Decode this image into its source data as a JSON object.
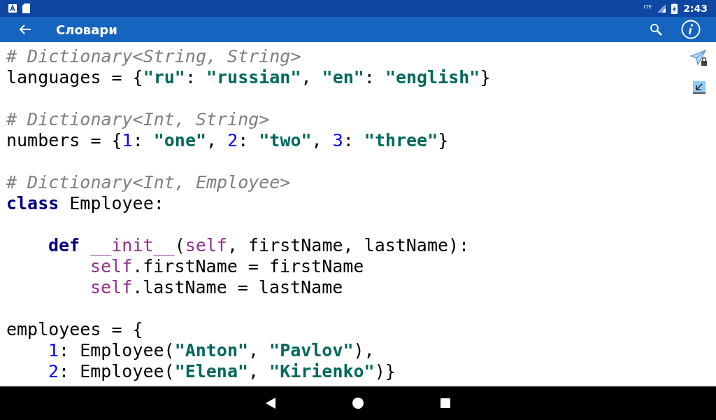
{
  "status_bar": {
    "time": "2:43",
    "network": "LTE"
  },
  "toolbar": {
    "title": "Словари"
  },
  "code_lines": [
    {
      "kind": "code",
      "tokens": [
        {
          "kind": "comment",
          "text": "# Dictionary<String, String>"
        }
      ]
    },
    {
      "kind": "code",
      "tokens": [
        {
          "kind": "plain",
          "text": "languages = {"
        },
        {
          "kind": "string",
          "text": "\"ru\""
        },
        {
          "kind": "plain",
          "text": ": "
        },
        {
          "kind": "string",
          "text": "\"russian\""
        },
        {
          "kind": "plain",
          "text": ", "
        },
        {
          "kind": "string",
          "text": "\"en\""
        },
        {
          "kind": "plain",
          "text": ": "
        },
        {
          "kind": "string",
          "text": "\"english\""
        },
        {
          "kind": "plain",
          "text": "}"
        }
      ]
    },
    {
      "kind": "blank"
    },
    {
      "kind": "code",
      "tokens": [
        {
          "kind": "comment",
          "text": "# Dictionary<Int, String>"
        }
      ]
    },
    {
      "kind": "code",
      "tokens": [
        {
          "kind": "plain",
          "text": "numbers = {"
        },
        {
          "kind": "number",
          "text": "1"
        },
        {
          "kind": "plain",
          "text": ": "
        },
        {
          "kind": "string",
          "text": "\"one\""
        },
        {
          "kind": "plain",
          "text": ", "
        },
        {
          "kind": "number",
          "text": "2"
        },
        {
          "kind": "plain",
          "text": ": "
        },
        {
          "kind": "string",
          "text": "\"two\""
        },
        {
          "kind": "plain",
          "text": ", "
        },
        {
          "kind": "number",
          "text": "3"
        },
        {
          "kind": "plain",
          "text": ": "
        },
        {
          "kind": "string",
          "text": "\"three\""
        },
        {
          "kind": "plain",
          "text": "}"
        }
      ]
    },
    {
      "kind": "blank"
    },
    {
      "kind": "code",
      "tokens": [
        {
          "kind": "comment",
          "text": "# Dictionary<Int, Employee>"
        }
      ]
    },
    {
      "kind": "code",
      "tokens": [
        {
          "kind": "keyword",
          "text": "class"
        },
        {
          "kind": "plain",
          "text": " Employee:"
        }
      ],
      "children": [
        {
          "kind": "blank"
        },
        {
          "kind": "code",
          "tokens": [
            {
              "kind": "keyword",
              "text": "def "
            },
            {
              "kind": "special",
              "text": "__init__"
            },
            {
              "kind": "plain",
              "text": "("
            },
            {
              "kind": "special",
              "text": "self"
            },
            {
              "kind": "plain",
              "text": ", firstName, lastName):"
            }
          ],
          "children": [
            {
              "kind": "code",
              "tokens": [
                {
                  "kind": "special",
                  "text": "self"
                },
                {
                  "kind": "plain",
                  "text": ".firstName = firstName"
                }
              ]
            },
            {
              "kind": "code",
              "tokens": [
                {
                  "kind": "special",
                  "text": "self"
                },
                {
                  "kind": "plain",
                  "text": ".lastName = lastName"
                }
              ]
            }
          ]
        }
      ]
    },
    {
      "kind": "blank"
    },
    {
      "kind": "code",
      "tokens": [
        {
          "kind": "plain",
          "text": "employees = {"
        }
      ],
      "children": [
        {
          "kind": "code",
          "tokens": [
            {
              "kind": "number",
              "text": "1"
            },
            {
              "kind": "plain",
              "text": ": Employee("
            },
            {
              "kind": "string",
              "text": "\"Anton\""
            },
            {
              "kind": "plain",
              "text": ", "
            },
            {
              "kind": "string",
              "text": "\"Pavlov\""
            },
            {
              "kind": "plain",
              "text": "),"
            }
          ]
        },
        {
          "kind": "code",
          "tokens": [
            {
              "kind": "number",
              "text": "2"
            },
            {
              "kind": "plain",
              "text": ": Employee("
            },
            {
              "kind": "string",
              "text": "\"Elena\""
            },
            {
              "kind": "plain",
              "text": ", "
            },
            {
              "kind": "string",
              "text": "\"Kirienko\""
            },
            {
              "kind": "plain",
              "text": ")}"
            }
          ]
        }
      ]
    }
  ]
}
